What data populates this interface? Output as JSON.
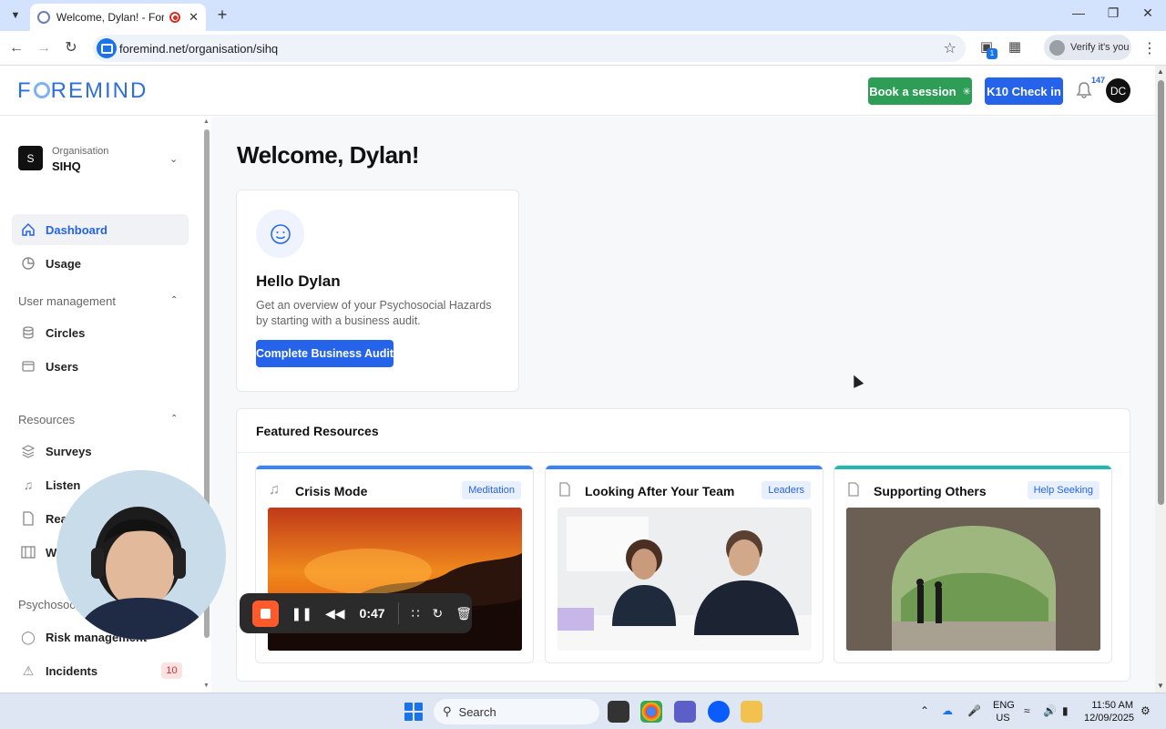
{
  "browser": {
    "tab_title": "Welcome, Dylan! - Foremind",
    "url": "foremind.net/organisation/sihq",
    "profile_label": "Verify it's you",
    "extension_badge": "1"
  },
  "header": {
    "logo_text": "FOREMIND",
    "book_label": "Book a session",
    "k10_label": "K10 Check in",
    "notification_count": "147",
    "avatar_initials": "DC"
  },
  "sidebar": {
    "org_initial": "S",
    "org_label": "Organisation",
    "org_name": "SIHQ",
    "items": [
      {
        "label": "Dashboard",
        "icon": "home-icon"
      },
      {
        "label": "Usage",
        "icon": "pie-chart-icon"
      }
    ],
    "user_mgmt_heading": "User management",
    "user_mgmt_items": [
      {
        "label": "Circles",
        "icon": "database-icon"
      },
      {
        "label": "Users",
        "icon": "users-icon"
      }
    ],
    "resources_heading": "Resources",
    "resources_items": [
      {
        "label": "Surveys",
        "icon": "layers-icon"
      },
      {
        "label": "Listen",
        "icon": "music-icon"
      },
      {
        "label": "Read",
        "icon": "file-icon"
      },
      {
        "label": "Watch",
        "icon": "film-icon"
      }
    ],
    "psycho_heading": "Psychosocial",
    "psycho_items": [
      {
        "label": "Risk management",
        "icon": "shield-icon"
      },
      {
        "label": "Incidents",
        "icon": "alert-icon",
        "badge": "10"
      }
    ]
  },
  "main": {
    "welcome": "Welcome, Dylan!",
    "hello_title": "Hello Dylan",
    "hello_text": "Get an overview of your Psychosocial Hazards by starting with a business audit.",
    "audit_button": "Complete Business Audit",
    "featured_title": "Featured Resources",
    "resources": [
      {
        "title": "Crisis Mode",
        "tag": "Meditation",
        "icon": "music-icon",
        "accent": "#3b82f6"
      },
      {
        "title": "Looking After Your Team",
        "tag": "Leaders",
        "icon": "file-icon",
        "accent": "#3b82f6"
      },
      {
        "title": "Supporting Others",
        "tag": "Help Seeking",
        "icon": "file-icon",
        "accent": "#22b8b0"
      }
    ]
  },
  "recorder": {
    "time": "0:47"
  },
  "taskbar": {
    "search_label": "Search",
    "lang_line1": "ENG",
    "lang_line2": "US",
    "time": "11:50 AM",
    "date": "12/09/2025"
  },
  "colors": {
    "brand_blue": "#2563eb",
    "book_green": "#2e9e57",
    "incident_red": "#d32f2f"
  }
}
